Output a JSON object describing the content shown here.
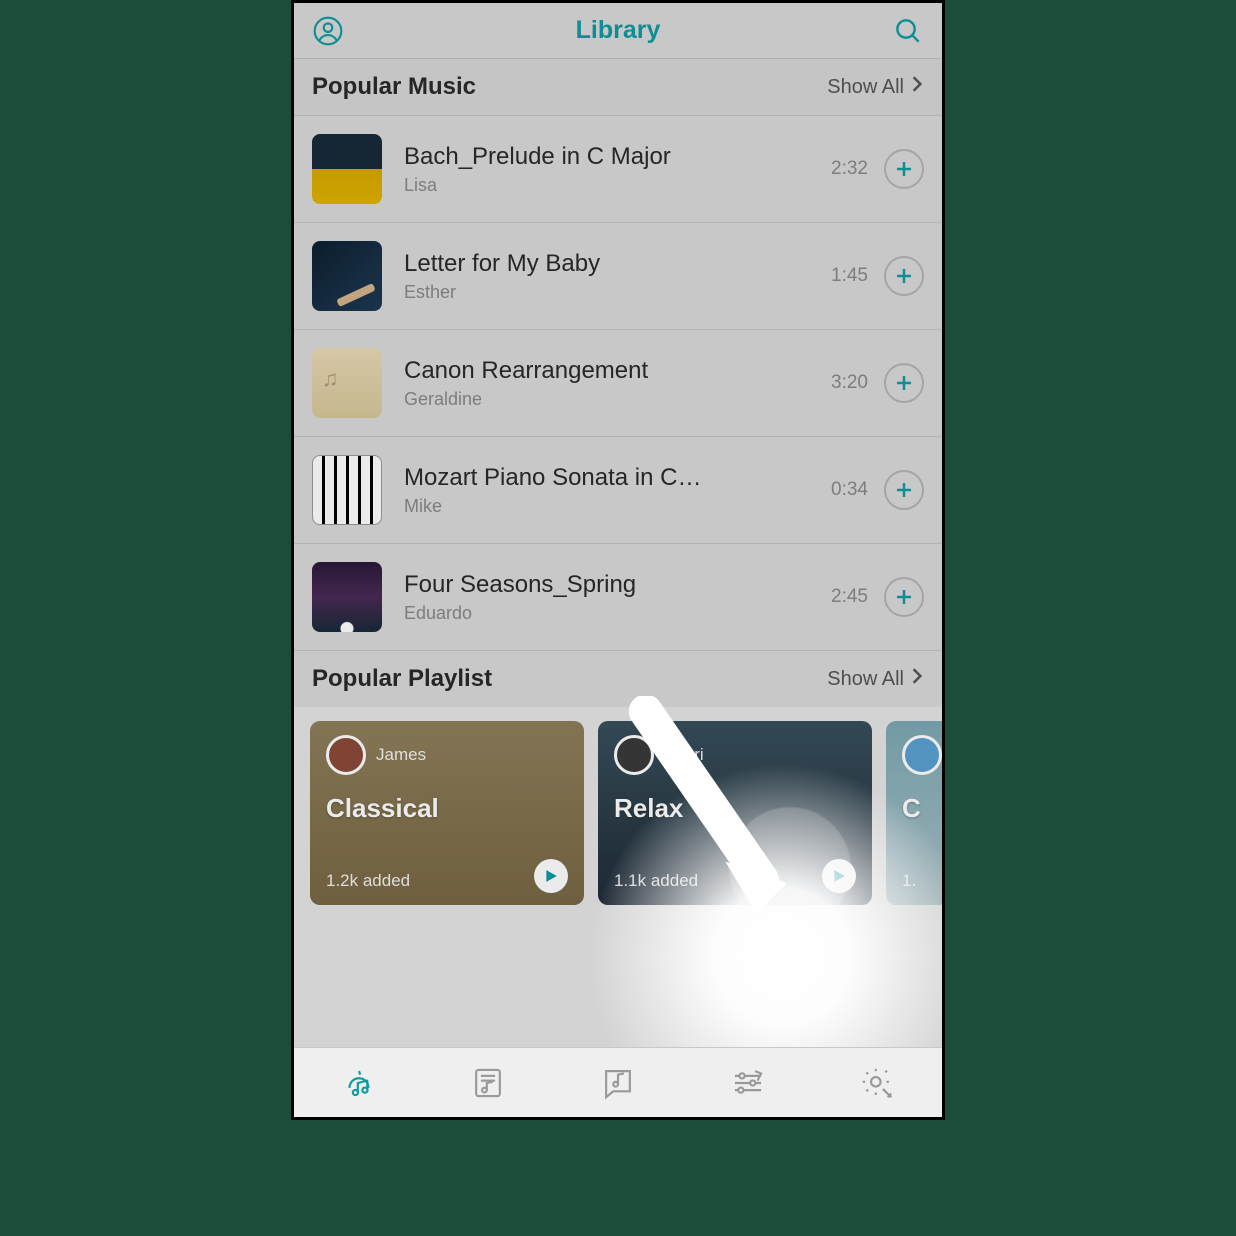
{
  "header": {
    "title": "Library"
  },
  "sections": {
    "popular_music": {
      "title": "Popular Music",
      "show_all": "Show All"
    },
    "popular_playlist": {
      "title": "Popular Playlist",
      "show_all": "Show All"
    }
  },
  "tracks": [
    {
      "title": "Bach_Prelude in C Major",
      "artist": "Lisa",
      "duration": "2:32"
    },
    {
      "title": "Letter for My Baby",
      "artist": "Esther",
      "duration": "1:45"
    },
    {
      "title": "Canon Rearrangement",
      "artist": "Geraldine",
      "duration": "3:20"
    },
    {
      "title": "Mozart Piano Sonata in C…",
      "artist": "Mike",
      "duration": "0:34"
    },
    {
      "title": "Four Seasons_Spring",
      "artist": "Eduardo",
      "duration": "2:45"
    }
  ],
  "playlists": [
    {
      "owner": "James",
      "title": "Classical",
      "added": "1.2k added"
    },
    {
      "owner": "Sheri",
      "title": "Relax",
      "added": "1.1k added"
    },
    {
      "owner": "",
      "title": "C",
      "added": "1."
    }
  ],
  "colors": {
    "accent": "#0f9aa1"
  }
}
